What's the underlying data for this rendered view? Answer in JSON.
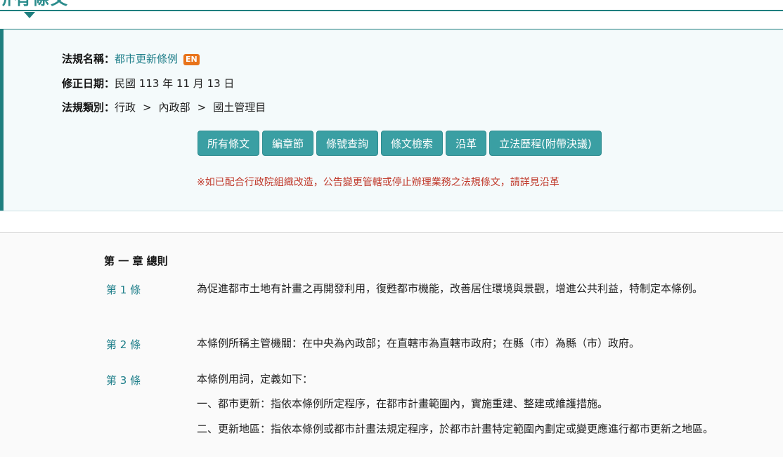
{
  "header": {
    "title": "所有條文"
  },
  "info": {
    "name_label": "法規名稱：",
    "name_value": "都市更新條例",
    "en_badge": "EN",
    "date_label": "修正日期：",
    "date_value": "民國 113 年 11 月 13 日",
    "category_label": "法規類別：",
    "category_path": [
      "行政",
      "內政部",
      "國土管理目"
    ],
    "separator": ">"
  },
  "tabs": [
    {
      "label": "所有條文"
    },
    {
      "label": "編章節"
    },
    {
      "label": "條號查詢"
    },
    {
      "label": "條文檢索"
    },
    {
      "label": "沿革"
    },
    {
      "label": "立法歷程(附帶決議)"
    }
  ],
  "notice": "※如已配合行政院組織改造，公告變更管轄或停止辦理業務之法規條文，請詳見沿革",
  "content": {
    "chapter": "第 一 章 總則",
    "articles": [
      {
        "number": "第 1 條",
        "text": "為促進都市土地有計畫之再開發利用，復甦都市機能，改善居住環境與景觀，增進公共利益，特制定本條例。"
      },
      {
        "number": "第 2 條",
        "text": "本條例所稱主管機關：在中央為內政部；在直轄市為直轄市政府；在縣（市）為縣（市）政府。"
      },
      {
        "number": "第 3 條",
        "text": "本條例用詞，定義如下：",
        "items": [
          "一、都市更新：指依本條例所定程序，在都市計畫範圍內，實施重建、整建或維護措施。",
          "二、更新地區：指依本條例或都市計畫法規定程序，於都市計畫特定範圍內劃定或變更應進行都市更新之地區。"
        ]
      }
    ]
  },
  "colors": {
    "accent": "#1f7f7f",
    "button": "#3a9fa3",
    "link": "#1f7f8a",
    "notice": "#c0392b",
    "badge": "#e8731a"
  }
}
